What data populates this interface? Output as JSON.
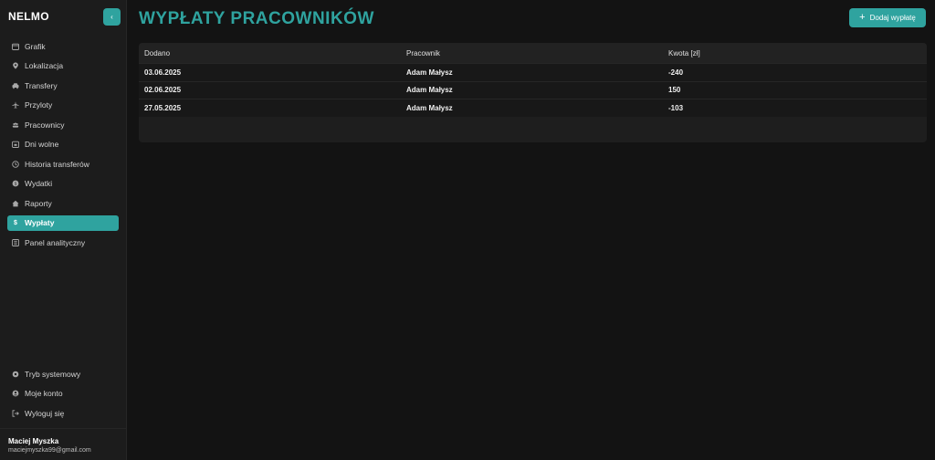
{
  "sidebar": {
    "brand": "NELMO",
    "collapse_icon": "chevron-left-icon",
    "items": [
      {
        "label": "Grafik",
        "icon": "calendar-icon"
      },
      {
        "label": "Lokalizacja",
        "icon": "map-pin-icon"
      },
      {
        "label": "Transfery",
        "icon": "car-icon"
      },
      {
        "label": "Przyloty",
        "icon": "plane-icon"
      },
      {
        "label": "Pracownicy",
        "icon": "users-icon"
      },
      {
        "label": "Dni wolne",
        "icon": "calendar-off-icon"
      },
      {
        "label": "Historia transferów",
        "icon": "history-icon"
      },
      {
        "label": "Wydatki",
        "icon": "coins-icon"
      },
      {
        "label": "Raporty",
        "icon": "home-icon"
      },
      {
        "label": "Wypłaty",
        "icon": "dollar-icon",
        "active": true
      },
      {
        "label": "Panel analityczny",
        "icon": "chart-icon"
      }
    ],
    "bottom_items": [
      {
        "label": "Tryb systemowy",
        "icon": "gear-icon"
      },
      {
        "label": "Moje konto",
        "icon": "user-circle-icon"
      },
      {
        "label": "Wyloguj się",
        "icon": "logout-icon"
      }
    ],
    "user": {
      "name": "Maciej Myszka",
      "email": "maciejmyszka99@gmail.com"
    }
  },
  "main": {
    "title": "Wypłaty pracowników",
    "add_button_label": "Dodaj wypłatę",
    "table": {
      "headers": [
        "Dodano",
        "Pracownik",
        "Kwota [zł]"
      ],
      "rows": [
        [
          "03.06.2025",
          "Adam Małysz",
          "-240"
        ],
        [
          "02.06.2025",
          "Adam Małysz",
          "150"
        ],
        [
          "27.05.2025",
          "Adam Małysz",
          "-103"
        ]
      ]
    }
  },
  "colors": {
    "accent": "#2fa39f",
    "background": "#131313",
    "sidebar": "#1c1c1c"
  }
}
